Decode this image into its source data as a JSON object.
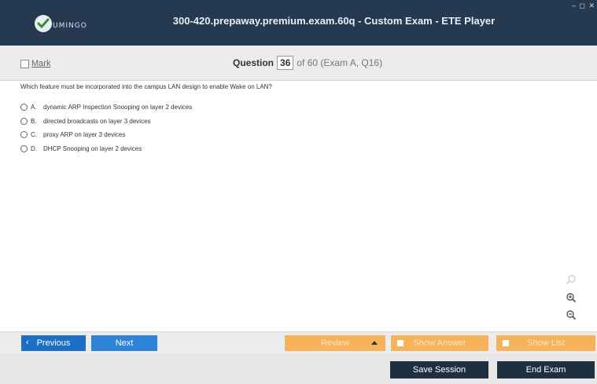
{
  "titlebar": {
    "logo_text": "UMINGO",
    "title": "300-420.prepaway.premium.exam.60q - Custom Exam - ETE Player",
    "window_controls": "– ◻ ✕",
    "bg_color": "#253a50"
  },
  "markbar": {
    "mark_label": "Mark",
    "question_word": "Question",
    "question_number": "36",
    "question_suffix": "of 60 (Exam A, Q16)"
  },
  "question": {
    "text": "Which feature must be incorporated into the campus LAN design to enable Wake on LAN?",
    "options": [
      {
        "letter": "A.",
        "text": "dynamic ARP Inspection Snooping on layer 2 devices"
      },
      {
        "letter": "B.",
        "text": "directed broadcasts on layer 3 devices"
      },
      {
        "letter": "C.",
        "text": "proxy ARP on layer 3 devices"
      },
      {
        "letter": "D.",
        "text": "DHCP Snooping on layer 2 devices"
      }
    ]
  },
  "zoom": {
    "search_icon": "search-icon",
    "zoom_in_icon": "zoom-in-icon",
    "zoom_out_icon": "zoom-out-icon"
  },
  "nav": {
    "previous": "Previous",
    "next": "Next",
    "review": "Review",
    "show_answer": "Show Answer",
    "show_list": "Show List",
    "colors": {
      "primary": "#1c6fc4",
      "accent": "#f7b25c"
    }
  },
  "footer": {
    "save_session": "Save Session",
    "end_exam": "End Exam",
    "button_color": "#1e2f40"
  }
}
